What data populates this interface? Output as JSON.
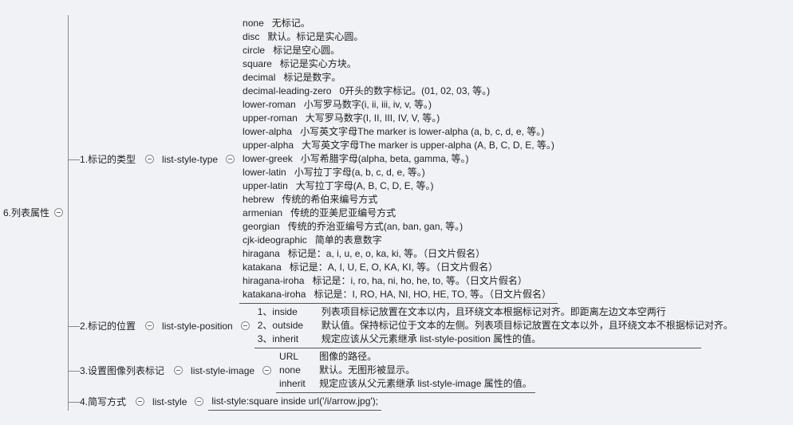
{
  "root": {
    "label": "6.列表属性"
  },
  "branches": {
    "b1": {
      "label": "1.标记的类型",
      "prop": "list-style-type"
    },
    "b2": {
      "label": "2.标记的位置",
      "prop": "list-style-position"
    },
    "b3": {
      "label": "3.设置图像列表标记",
      "prop": "list-style-image"
    },
    "b4": {
      "label": "4.简写方式",
      "prop": "list-style",
      "value": "list-style:square inside url('/i/arrow.jpg');"
    }
  },
  "type_rows": [
    {
      "k": "none",
      "v": "无标记。"
    },
    {
      "k": "disc",
      "v": "默认。标记是实心圆。"
    },
    {
      "k": "circle",
      "v": "标记是空心圆。"
    },
    {
      "k": "square",
      "v": "标记是实心方块。"
    },
    {
      "k": "decimal",
      "v": "标记是数字。"
    },
    {
      "k": "decimal-leading-zero",
      "v": "0开头的数字标记。(01, 02, 03, 等。)"
    },
    {
      "k": "lower-roman",
      "v": "小写罗马数字(i, ii, iii, iv, v, 等。)"
    },
    {
      "k": "upper-roman",
      "v": "大写罗马数字(I, II, III, IV, V, 等。)"
    },
    {
      "k": "lower-alpha",
      "v": "小写英文字母The marker is lower-alpha (a, b, c, d, e, 等。)"
    },
    {
      "k": "upper-alpha",
      "v": "大写英文字母The marker is upper-alpha (A, B, C, D, E, 等。)"
    },
    {
      "k": "lower-greek",
      "v": "小写希腊字母(alpha, beta, gamma, 等。)"
    },
    {
      "k": "lower-latin",
      "v": "小写拉丁字母(a, b, c, d, e, 等。)"
    },
    {
      "k": "upper-latin",
      "v": "大写拉丁字母(A, B, C, D, E, 等。)"
    },
    {
      "k": "hebrew",
      "v": "传统的希伯来编号方式"
    },
    {
      "k": "armenian",
      "v": "传统的亚美尼亚编号方式"
    },
    {
      "k": "georgian",
      "v": "传统的乔治亚编号方式(an, ban, gan, 等。)"
    },
    {
      "k": "cjk-ideographic",
      "v": "简单的表意数字"
    },
    {
      "k": "hiragana",
      "v": "标记是：a, i, u, e, o, ka, ki, 等。（日文片假名）"
    },
    {
      "k": "katakana",
      "v": "标记是：A, I, U, E, O, KA, KI, 等。（日文片假名）"
    },
    {
      "k": "hiragana-iroha",
      "v": "标记是：i, ro, ha, ni, ho, he, to, 等。（日文片假名）"
    },
    {
      "k": "katakana-iroha",
      "v": "标记是：I, RO, HA, NI, HO, HE, TO, 等。（日文片假名）"
    }
  ],
  "position_rows": [
    {
      "k": "1、inside",
      "v": "列表项目标记放置在文本以内，且环绕文本根据标记对齐。即距离左边文本空两行"
    },
    {
      "k": "2、outside",
      "v": "默认值。保持标记位于文本的左侧。列表项目标记放置在文本以外，且环绕文本不根据标记对齐。"
    },
    {
      "k": "3、inherit",
      "v": "规定应该从父元素继承 list-style-position 属性的值。"
    }
  ],
  "image_rows": [
    {
      "k": "URL",
      "v": "图像的路径。"
    },
    {
      "k": "none",
      "v": "默认。无图形被显示。"
    },
    {
      "k": "inherit",
      "v": "规定应该从父元素继承 list-style-image 属性的值。"
    }
  ]
}
